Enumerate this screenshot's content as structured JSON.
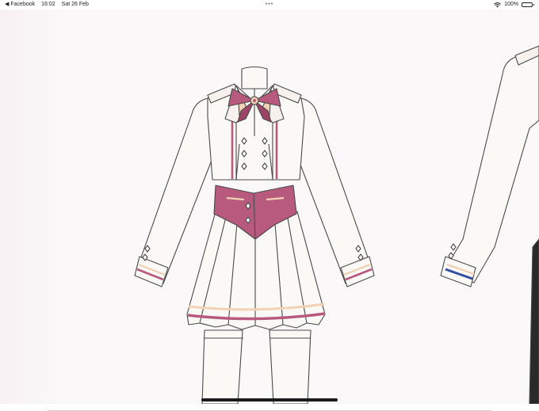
{
  "status_bar": {
    "back_app": "Facebook",
    "time": "16:02",
    "date": "Sat 26 Feb",
    "dots": "•••",
    "battery": "100%"
  },
  "icons": {
    "back": "back-triangle-icon",
    "wifi": "wifi-icon",
    "battery": "battery-icon"
  },
  "colors": {
    "accent_pink": "#b85a7e",
    "garment_white": "#fbf9f6",
    "stripe_cream": "#f2d2b4",
    "stripe_blue": "#2f4ea0",
    "outline": "#4a4a4a"
  },
  "image": {
    "description_visible": ""
  }
}
